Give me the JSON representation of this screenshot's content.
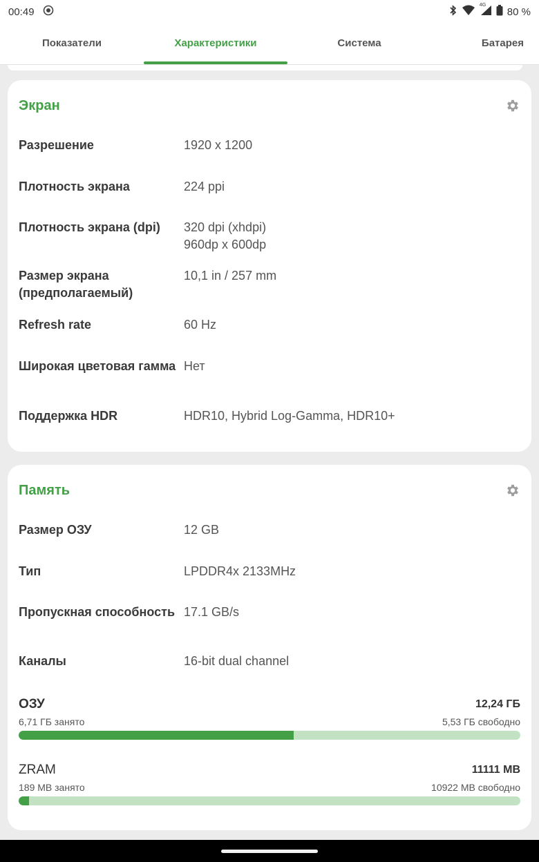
{
  "statusbar": {
    "time": "00:49",
    "battery": "80 %",
    "net": "4G"
  },
  "tabs": [
    {
      "label": "Показатели"
    },
    {
      "label": "Характеристики"
    },
    {
      "label": "Система"
    },
    {
      "label": "Батарея"
    }
  ],
  "screen_card": {
    "title": "Экран",
    "rows": [
      {
        "label": "Разрешение",
        "value": "1920 x 1200"
      },
      {
        "label": "Плотность экрана",
        "value": "224 ppi"
      },
      {
        "label": "Плотность экрана (dpi)",
        "value": "320 dpi (xhdpi)\n960dp x 600dp"
      },
      {
        "label": "Размер экрана (предполагаемый)",
        "value": "10,1 in / 257 mm"
      },
      {
        "label": "Refresh rate",
        "value": "60 Hz"
      },
      {
        "label": "Широкая цветовая гамма",
        "value": "Нет"
      },
      {
        "label": "Поддержка HDR",
        "value": "HDR10, Hybrid Log-Gamma, HDR10+"
      }
    ]
  },
  "memory_card": {
    "title": "Память",
    "rows": [
      {
        "label": "Размер ОЗУ",
        "value": "12 GB"
      },
      {
        "label": "Тип",
        "value": "LPDDR4x 2133MHz"
      },
      {
        "label": "Пропускная способность",
        "value": "17.1 GB/s"
      },
      {
        "label": "Каналы",
        "value": "16-bit dual channel"
      }
    ],
    "ram": {
      "name": "ОЗУ",
      "total": "12,24 ГБ",
      "used": "6,71 ГБ занято",
      "free": "5,53 ГБ свободно",
      "fraction": 0.548
    },
    "zram": {
      "name": "ZRAM",
      "total": "11111 MB",
      "used": "189 MB занято",
      "free": "10922 MB свободно",
      "fraction": 0.017
    }
  },
  "colors": {
    "accent": "#43a047",
    "bar_track": "#c3e2c4"
  }
}
